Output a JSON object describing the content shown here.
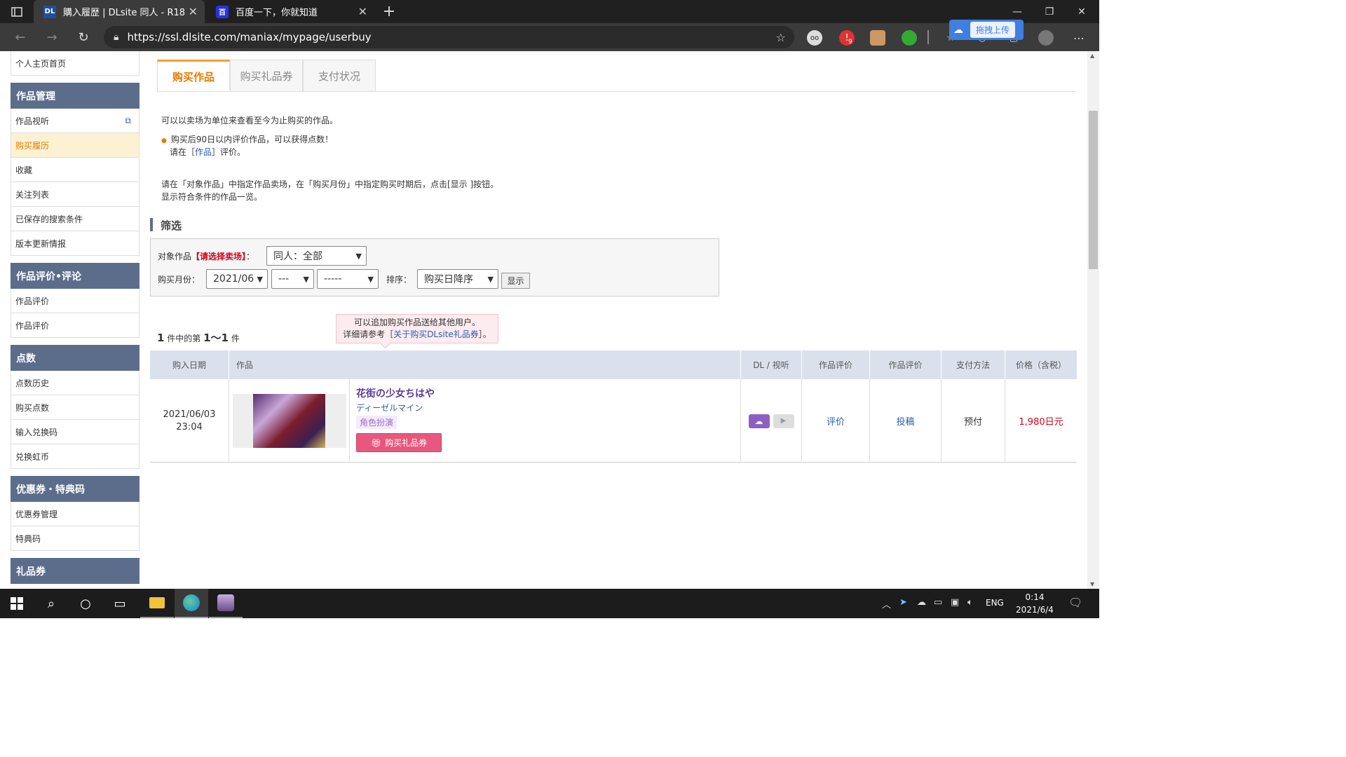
{
  "browser": {
    "tabs": [
      {
        "title": "購入履歴 | DLsite 同人 - R18",
        "favicon": "DL"
      },
      {
        "title": "百度一下，你就知道",
        "favicon": "百"
      }
    ],
    "url": "https://ssl.dlsite.com/maniax/mypage/userbuy",
    "baidu_upload": "拖拽上传",
    "ext_badge": "9"
  },
  "sidebar": {
    "top_item": "个人主页首页",
    "sections": [
      {
        "title": "作品管理",
        "items": [
          "作品视听",
          "购买履历",
          "收藏",
          "关注列表",
          "已保存的搜索条件",
          "版本更新情报"
        ]
      },
      {
        "title": "作品评价•评论",
        "items": [
          "作品评价",
          "作品评价"
        ]
      },
      {
        "title": "点数",
        "items": [
          "点数历史",
          "购买点数",
          "输入兑换码",
          "兑换虹币"
        ]
      },
      {
        "title": "优惠券・特典码",
        "items": [
          "优惠券管理",
          "特典码"
        ]
      },
      {
        "title": "礼品券",
        "items": []
      }
    ]
  },
  "page_tabs": [
    "购买作品",
    "购买礼品券",
    "支付状况"
  ],
  "intro": {
    "line1": "可以以卖场为单位来查看至今为止购买的作品。",
    "bullet1": "购买后90日以内评价作品，可以获得点数！",
    "bullet2_pre": "请在［",
    "bullet2_link": "作品",
    "bullet2_post": "］评价。",
    "line3": "请在「对象作品」中指定作品卖场，在「购买月份」中指定购买时期后，点击[显示 ]按钮。",
    "line4": "显示符合条件的作品一览。"
  },
  "filter": {
    "heading": "筛选",
    "target_label": "对象作品",
    "target_hint": "【请选择卖场】",
    "colon": "：",
    "target_value": "同人：全部",
    "month_label": "购买月份：",
    "year_month": "2021/06",
    "day": "---",
    "extra": "-----",
    "sort_label": "排序：",
    "sort_value": "购买日降序",
    "show_button": "显示"
  },
  "tip": {
    "line1": "可以追加购买作品送给其他用户。",
    "pre": "详细请参考［",
    "link": "关于购买DLsite礼品券",
    "post": "］。"
  },
  "result": {
    "pre": "件中的第",
    "total": "1",
    "range": "1～1",
    "post": "件"
  },
  "table": {
    "headers": [
      "购入日期",
      "作品",
      "DL / 视听",
      "作品评价",
      "作品评价",
      "支付方法",
      "价格（含税）"
    ],
    "rows": [
      {
        "date": "2021/06/03",
        "time": "23:04",
        "title": "花街の少女ちはや",
        "circle": "ディーゼルマイン",
        "genre": "角色扮演",
        "gift_button": "购买礼品券",
        "review": "评价",
        "post": "投稿",
        "payment": "预付",
        "price": "1,980日元"
      }
    ]
  },
  "taskbar": {
    "lang": "ENG",
    "time": "0:14",
    "date": "2021/6/4"
  },
  "colors": {
    "accent": "#e67c00",
    "sidebar_head": "#5c6d8c",
    "price": "#d0021b",
    "gift": "#e8577e",
    "dl": "#8e5fc1"
  }
}
